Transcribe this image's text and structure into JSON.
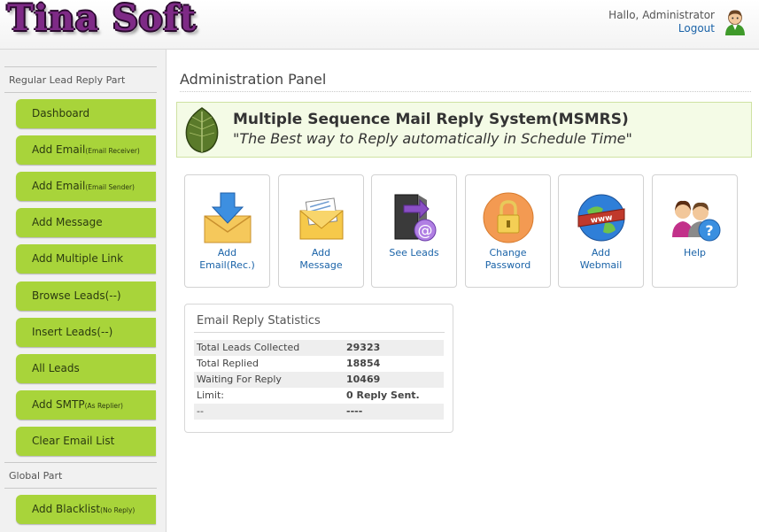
{
  "header": {
    "logo_text": "Tina Soft",
    "greeting": "Hallo, Administrator",
    "logout_label": "Logout"
  },
  "sidebar": {
    "section_regular": "Regular Lead Reply Part",
    "section_global": "Global Part",
    "items": [
      {
        "label": "Dashboard",
        "note": ""
      },
      {
        "label": "Add Email",
        "note": "(Email Receiver)"
      },
      {
        "label": "Add Email",
        "note": "(Email Sender)"
      },
      {
        "label": "Add Message",
        "note": ""
      },
      {
        "label": "Add Multiple Link",
        "note": ""
      },
      {
        "label": "Browse Leads(--)",
        "note": ""
      },
      {
        "label": "Insert Leads(--)",
        "note": ""
      },
      {
        "label": "All Leads",
        "note": ""
      },
      {
        "label": "Add SMTP",
        "note": "(As Replier)"
      },
      {
        "label": "Clear Email List",
        "note": ""
      }
    ],
    "global_items": [
      {
        "label": "Add Blacklist",
        "note": "(No Reply)"
      }
    ]
  },
  "main": {
    "panel_title": "Administration Panel",
    "banner_title": "Multiple Sequence Mail Reply System(MSMRS)",
    "banner_subtitle": "\"The Best way to Reply automatically in Schedule Time\"",
    "tiles": [
      {
        "line1": "Add",
        "line2": "Email(Rec.)",
        "icon": "download-envelope-icon"
      },
      {
        "line1": "Add",
        "line2": "Message",
        "icon": "envelope-letter-icon"
      },
      {
        "line1": "See Leads",
        "line2": "",
        "icon": "at-sign-door-icon"
      },
      {
        "line1": "Change",
        "line2": "Password",
        "icon": "padlock-icon"
      },
      {
        "line1": "Add",
        "line2": "Webmail",
        "icon": "globe-www-icon"
      },
      {
        "line1": "Help",
        "line2": "",
        "icon": "help-people-icon"
      }
    ],
    "stats": {
      "title": "Email Reply Statistics",
      "rows": [
        {
          "label": "Total Leads Collected",
          "value": "29323"
        },
        {
          "label": "Total Replied",
          "value": "18854"
        },
        {
          "label": "Waiting For Reply",
          "value": "10469"
        },
        {
          "label": "Limit:",
          "value": "0 Reply Sent."
        },
        {
          "label": "--",
          "value": "----"
        }
      ]
    }
  },
  "colors": {
    "nav_green": "#a8d43a",
    "link_blue": "#1a63a8",
    "logo_purple": "#7e2a86",
    "banner_bg": "#f4fbe6"
  }
}
